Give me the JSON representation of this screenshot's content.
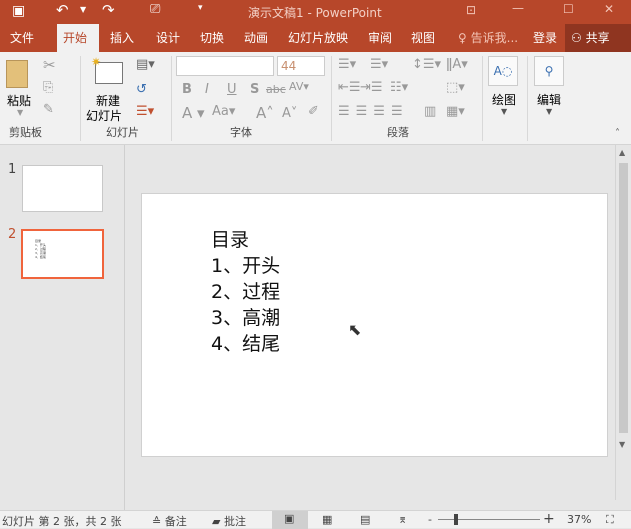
{
  "title": "演示文稿1 - PowerPoint",
  "tabs": [
    "文件",
    "开始",
    "插入",
    "设计",
    "切换",
    "动画",
    "幻灯片放映",
    "审阅",
    "视图"
  ],
  "tell_me": "告诉我...",
  "sign_in": "登录",
  "share": "共享",
  "ribbon": {
    "paste": "粘贴",
    "new_slide_1": "新建",
    "new_slide_2": "幻灯片",
    "font_size": "44",
    "font_name": "",
    "draw": "绘图",
    "edit": "编辑",
    "groups": [
      "剪贴板",
      "幻灯片",
      "字体",
      "段落"
    ]
  },
  "thumbnails": [
    {
      "number": "1"
    },
    {
      "number": "2"
    }
  ],
  "slide": {
    "lines": [
      "目录",
      "1、开头",
      "2、过程",
      "3、高潮",
      "4、结尾"
    ]
  },
  "status": {
    "slide_info": "幻灯片 第 2 张，共 2 张",
    "notes": "备注",
    "comments": "批注",
    "zoom": "37%",
    "zoom_minus": "-",
    "zoom_plus": "+"
  },
  "colors": {
    "accent": "#b7472a",
    "selected_thumb": "#f0643c"
  }
}
